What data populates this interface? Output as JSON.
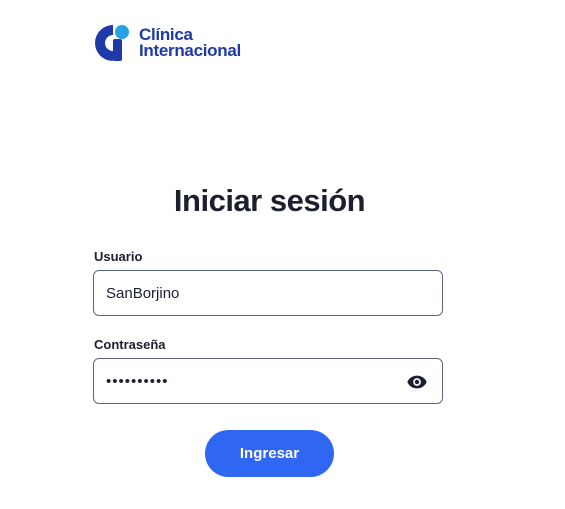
{
  "brand": {
    "line1": "Clínica",
    "line2": "Internacional",
    "color": "#1e3aa8",
    "accent": "#25a3e6"
  },
  "login": {
    "title": "Iniciar sesión",
    "username_label": "Usuario",
    "username_value": "SanBorjino",
    "password_label": "Contraseña",
    "password_value": "••••••••••",
    "show_password_icon": "eye-icon",
    "submit_label": "Ingresar",
    "submit_color": "#2f66f2"
  }
}
